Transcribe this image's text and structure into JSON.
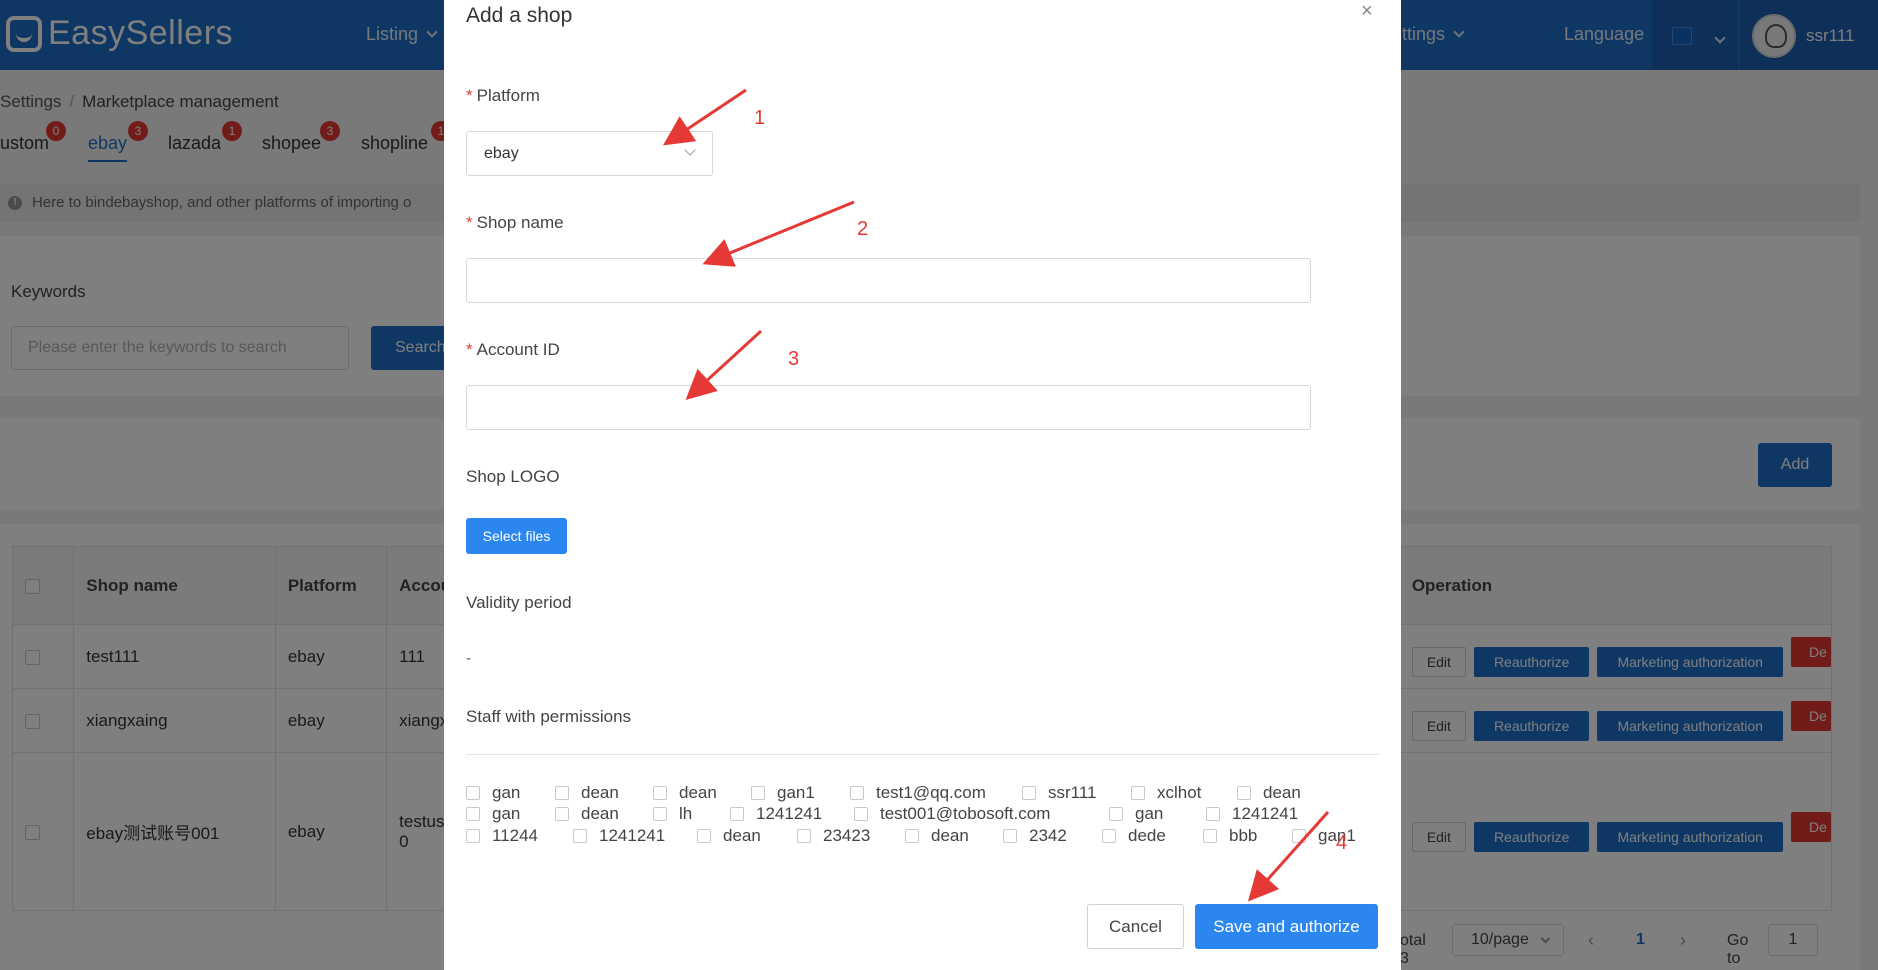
{
  "header": {
    "logo_text": "EasySellers",
    "nav_listing": "Listing",
    "nav_settings": "ttings",
    "language_label": "Language",
    "username": "ssr111"
  },
  "breadcrumb": {
    "root": "Settings",
    "separator": "/",
    "current": "Marketplace management"
  },
  "tabs": [
    {
      "label": "ustom",
      "badge": "0"
    },
    {
      "label": "ebay",
      "badge": "3"
    },
    {
      "label": "lazada",
      "badge": "1"
    },
    {
      "label": "shopee",
      "badge": "3"
    },
    {
      "label": "shopline",
      "badge": "1"
    }
  ],
  "notice": {
    "text": "Here to bindebayshop, and other platforms of importing o"
  },
  "filter": {
    "keywords_label": "Keywords",
    "keywords_placeholder": "Please enter the keywords to search",
    "search_label": "Search"
  },
  "toolbar": {
    "add_label": "Add"
  },
  "table": {
    "headers": {
      "shop_name": "Shop name",
      "platform": "Platform",
      "account": "Accou",
      "operation": "Operation"
    },
    "rows": [
      {
        "shop_name": "test111",
        "platform": "ebay",
        "account": "111",
        "account2": ""
      },
      {
        "shop_name": "xiangxaing",
        "platform": "ebay",
        "account": "xiangx",
        "account2": ""
      },
      {
        "shop_name": "ebay测试账号001",
        "platform": "ebay",
        "account": "testus",
        "account2": "0"
      }
    ],
    "ops": {
      "edit": "Edit",
      "reauthorize": "Reauthorize",
      "marketing": "Marketing authorization",
      "delete": "De"
    }
  },
  "pagination": {
    "total": "otal 3",
    "page_size": "10/page",
    "prev": "‹",
    "current_page": "1",
    "next": "›",
    "goto_label": "Go to",
    "goto_value": "1"
  },
  "modal": {
    "title": "Add a shop",
    "close": "×",
    "platform_label": "Platform",
    "platform_value": "ebay",
    "shop_name_label": "Shop name",
    "shop_name_value": "",
    "account_id_label": "Account ID",
    "account_id_value": "",
    "logo_label": "Shop LOGO",
    "select_files": "Select files",
    "validity_label": "Validity period",
    "validity_value": "-",
    "staff_label": "Staff with permissions",
    "staff_rows": [
      [
        "gan",
        "dean",
        "dean",
        "gan1",
        "test1@qq.com",
        "ssr111",
        "xclhot",
        "dean"
      ],
      [
        "gan",
        "dean",
        "lh",
        "1241241",
        "test001@tobosoft.com",
        "gan",
        "1241241"
      ],
      [
        "11244",
        "1241241",
        "dean",
        "23423",
        "dean",
        "2342",
        "dede",
        "bbb",
        "gan1"
      ]
    ],
    "cancel": "Cancel",
    "save": "Save and authorize"
  },
  "annotations": {
    "n1": "1",
    "n2": "2",
    "n3": "3",
    "n4": "4",
    "color": "#e53935"
  },
  "colors": {
    "brand": "#1f6fc8",
    "primary_button": "#2b87ef",
    "danger": "#e53935"
  }
}
